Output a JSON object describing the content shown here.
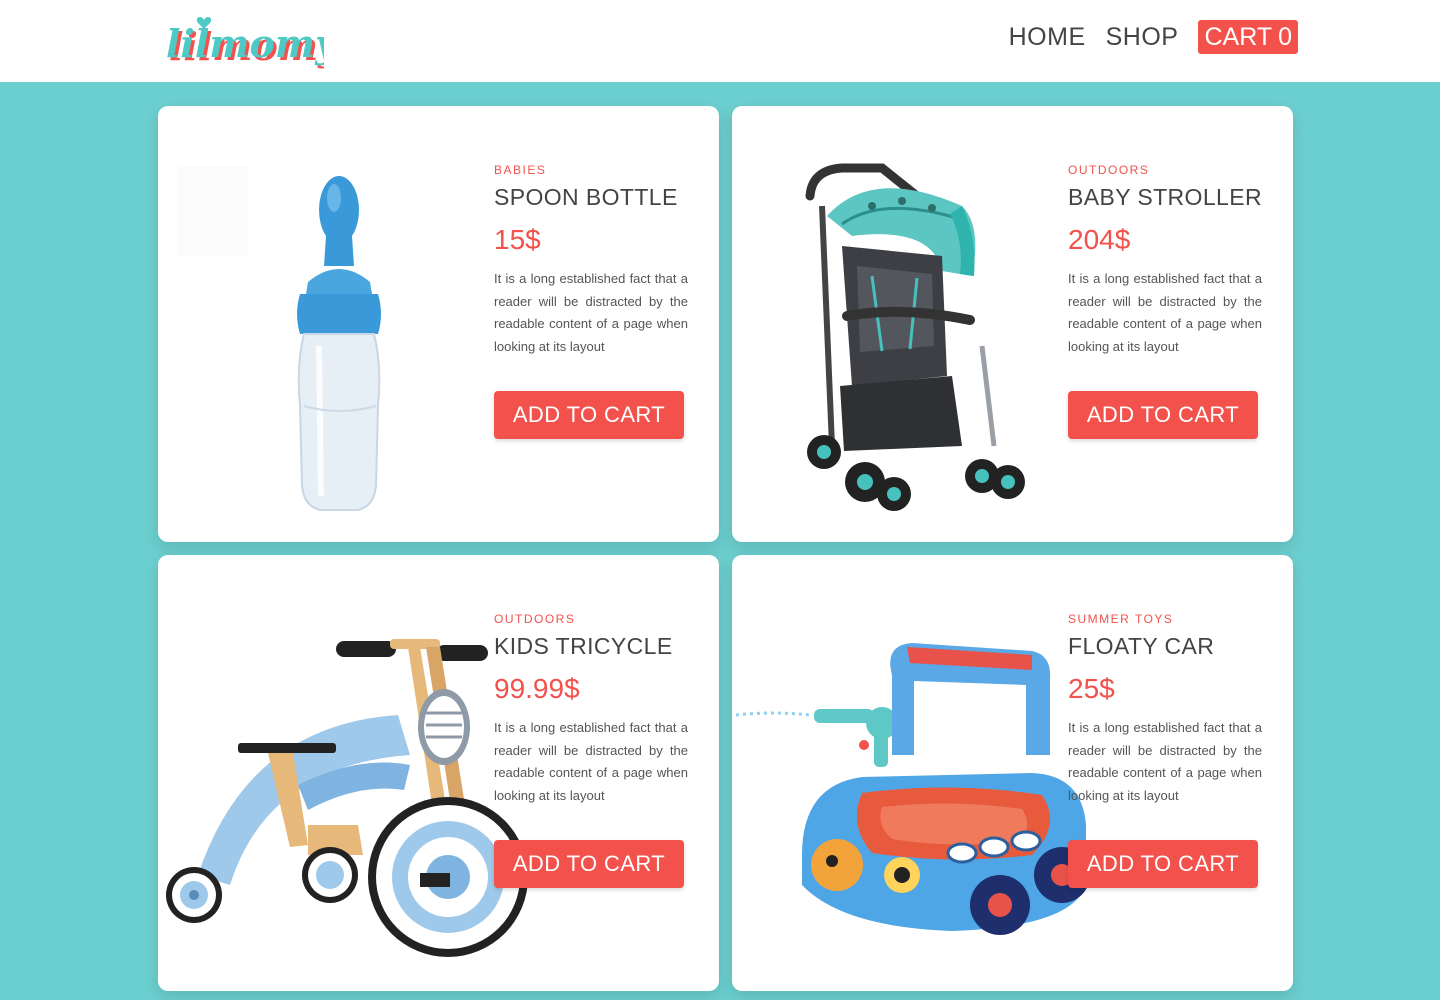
{
  "brand": {
    "name": "lilmomy"
  },
  "nav": {
    "home": "HOME",
    "shop": "SHOP",
    "cart": "CART",
    "cart_count": "0"
  },
  "products": [
    {
      "category": "BABIES",
      "name": "SPOON BOTTLE",
      "price": "15$",
      "description": "It is a long established fact that a reader will be distracted by the readable content of a page when looking at its layout",
      "button": "ADD TO CART",
      "image": "spoon-bottle-image"
    },
    {
      "category": "OUTDOORS",
      "name": "BABY STROLLER",
      "price": "204$",
      "description": "It is a long established fact that a reader will be distracted by the readable content of a page when looking at its layout",
      "button": "ADD TO CART",
      "image": "baby-stroller-image"
    },
    {
      "category": "OUTDOORS",
      "name": "KIDS TRICYCLE",
      "price": "99.99$",
      "description": "It is a long established fact that a reader will be distracted by the readable content of a page when looking at its layout",
      "button": "ADD TO CART",
      "image": "kids-tricycle-image"
    },
    {
      "category": "SUMMER TOYS",
      "name": "FLOATY CAR",
      "price": "25$",
      "description": "It is a long established fact that a reader will be distracted by the readable content of a page when looking at its layout",
      "button": "ADD TO CART",
      "image": "floaty-car-image"
    }
  ],
  "colors": {
    "accent": "#f2514c",
    "background": "#6ccfcf",
    "brand_teal": "#4ec9c6",
    "text": "#444444"
  }
}
